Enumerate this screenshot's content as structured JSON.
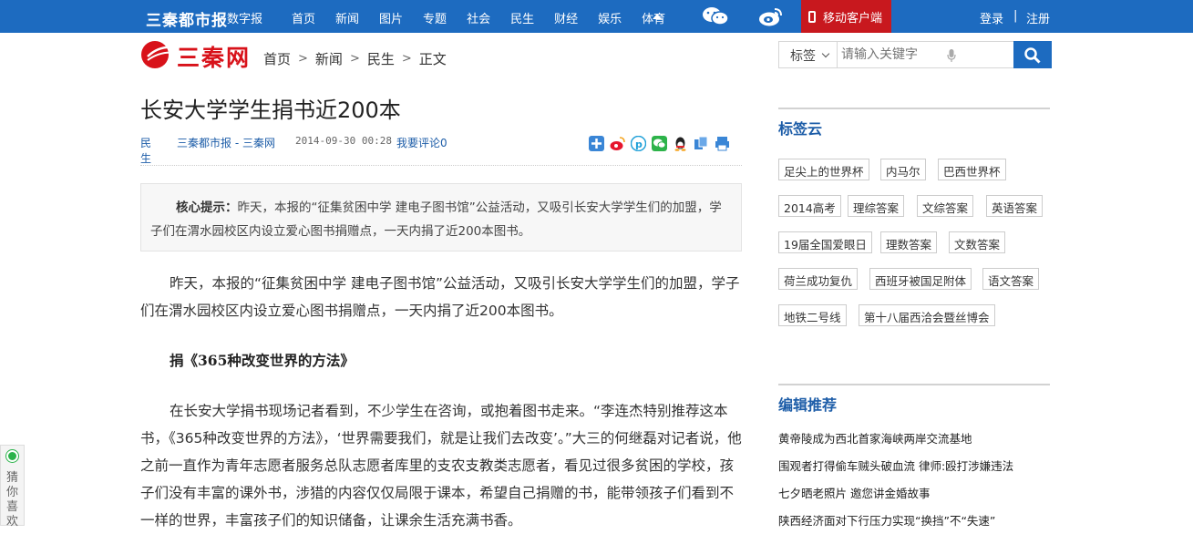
{
  "topbar": {
    "brand": "三秦都市报",
    "brand_sub": "数字报",
    "nav": [
      "首页",
      "新闻",
      "图片",
      "专题",
      "社会",
      "民生",
      "财经",
      "娱乐",
      "体育"
    ],
    "mobile_client": "移动客户端",
    "login": "登录",
    "separator": "|",
    "register": "注册"
  },
  "logo_text": "三秦网",
  "breadcrumb": [
    "首页",
    "新闻",
    "民生",
    "正文"
  ],
  "breadcrumb_sep": ">",
  "search": {
    "category": "标签",
    "placeholder": "请输入关键字"
  },
  "article": {
    "title": "长安大学学生捐书近200本",
    "category": "民生",
    "source": "三秦都市报 - 三秦网",
    "date": "2014-09-30 00:28",
    "comment_link": "我要评论0",
    "summary_label": "核心提示：",
    "summary_text": "昨天，本报的“征集贫困中学 建电子图书馆”公益活动，又吸引长安大学学生们的加盟，学子们在渭水园校区内设立爱心图书捐赠点，一天内捐了近200本图书。",
    "para1": "昨天，本报的“征集贫困中学 建电子图书馆”公益活动，又吸引长安大学学生们的加盟，学子们在渭水园校区内设立爱心图书捐赠点，一天内捐了近200本图书。",
    "subheading": "捐《365种改变世界的方法》",
    "para2": "在长安大学捐书现场记者看到，不少学生在咨询，或抱着图书走来。“李连杰特别推荐这本书，《365种改变世界的方法》，‘世界需要我们，就是让我们去改变’。”大三的何继磊对记者说，他之前一直作为青年志愿者服务总队志愿者库里的支农支教类志愿者，看见过很多贫困的学校，孩子们没有丰富的课外书，涉猎的内容仅仅局限于课本，希望自己捐赠的书，能带领孩子们看到不一样的世界，丰富孩子们的知识储备，让课余生活充满书香。"
  },
  "sidebar": {
    "tag_cloud_title": "标签云",
    "tags": [
      "足尖上的世界杯",
      "内马尔",
      "巴西世界杯",
      "2014高考",
      "理综答案",
      "文综答案",
      "英语答案",
      "19届全国爱眼日",
      "理数答案",
      "文数答案",
      "荷兰成功复仇",
      "西班牙被国足附体",
      "语文答案",
      "地铁二号线",
      "第十八届西洽会暨丝博会"
    ],
    "recommend_title": "编辑推荐",
    "recommend": [
      "黄帝陵成为西北首家海峡两岸交流基地",
      "围观者打得偷车贼头破血流 律师:殴打涉嫌违法",
      "七夕晒老照片 邀您讲金婚故事",
      "陕西经济面对下行压力实现“换挡”不“失速”"
    ]
  },
  "guess_widget": "猜你喜欢",
  "colors": {
    "top_bar": "#1d6bc0",
    "mobile_button": "#c8181e",
    "link": "#1d5da8",
    "logo_red": "#d8121a"
  }
}
